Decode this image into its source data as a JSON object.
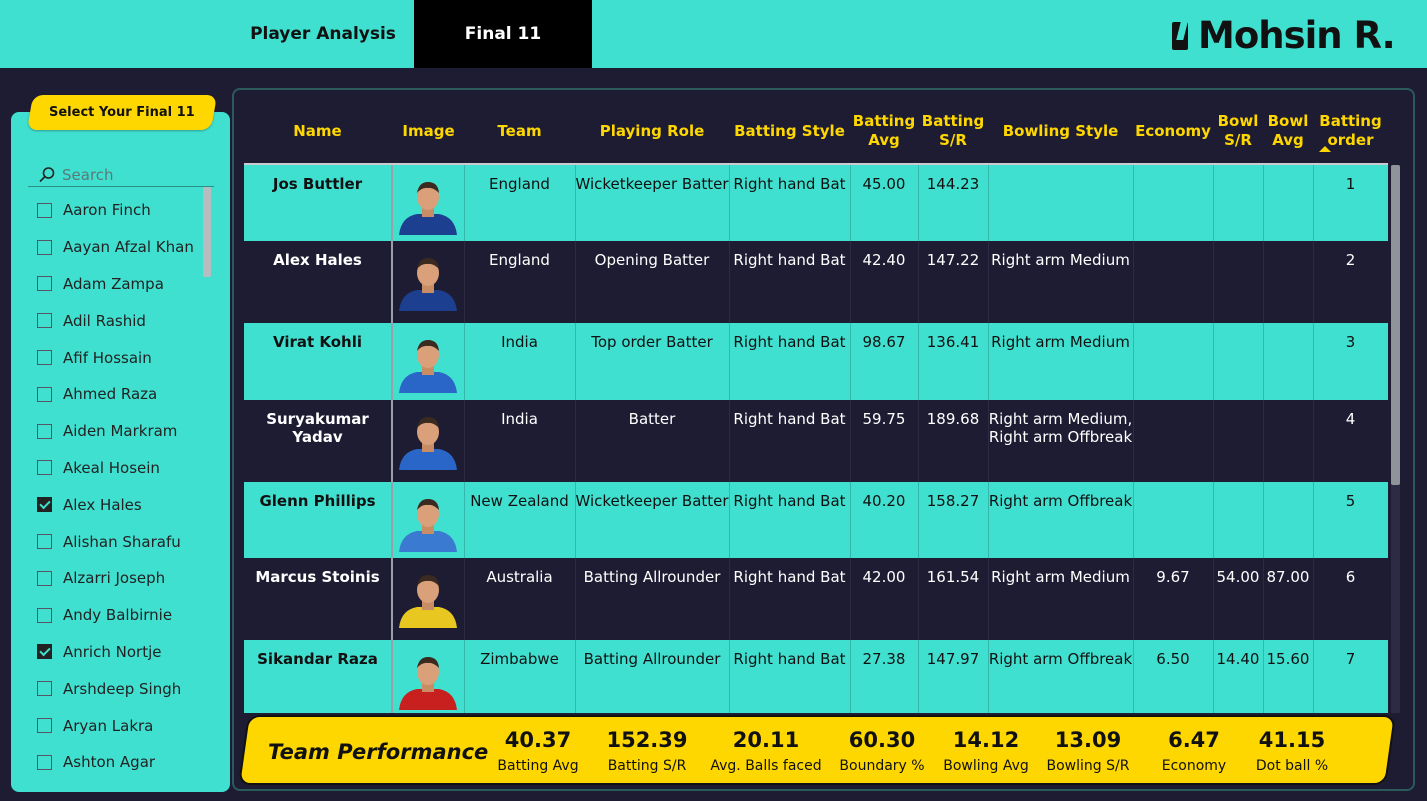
{
  "tabs": [
    {
      "label": "Player Analysis"
    },
    {
      "label": "Final 11"
    }
  ],
  "logo": "Mohsin R.",
  "slicer": {
    "title": "Select Your Final 11",
    "search_placeholder": "Search",
    "items": [
      {
        "label": "Aaron Finch",
        "checked": false
      },
      {
        "label": "Aayan Afzal Khan",
        "checked": false
      },
      {
        "label": "Adam Zampa",
        "checked": false
      },
      {
        "label": "Adil Rashid",
        "checked": false
      },
      {
        "label": "Afif Hossain",
        "checked": false
      },
      {
        "label": "Ahmed Raza",
        "checked": false
      },
      {
        "label": "Aiden Markram",
        "checked": false
      },
      {
        "label": "Akeal Hosein",
        "checked": false
      },
      {
        "label": "Alex Hales",
        "checked": true
      },
      {
        "label": "Alishan Sharafu",
        "checked": false
      },
      {
        "label": "Alzarri Joseph",
        "checked": false
      },
      {
        "label": "Andy Balbirnie",
        "checked": false
      },
      {
        "label": "Anrich Nortje",
        "checked": true
      },
      {
        "label": "Arshdeep Singh",
        "checked": false
      },
      {
        "label": "Aryan Lakra",
        "checked": false
      },
      {
        "label": "Ashton Agar",
        "checked": false
      }
    ]
  },
  "table": {
    "headers": [
      "Name",
      "Image",
      "Team",
      "Playing Role",
      "Batting Style",
      "Batting Avg",
      "Batting S/R",
      "Bowling Style",
      "Economy",
      "Bowl S/R",
      "Bowl Avg",
      "Batting order"
    ],
    "rows": [
      {
        "name": "Jos Buttler",
        "team": "England",
        "role": "Wicketkeeper Batter",
        "bat_style": "Right hand Bat",
        "bat_avg": "45.00",
        "bat_sr": "144.23",
        "bowl_style": "",
        "economy": "",
        "bowl_sr": "",
        "bowl_avg": "",
        "order": "1",
        "jersey": "#1d3f8f"
      },
      {
        "name": "Alex Hales",
        "team": "England",
        "role": "Opening Batter",
        "bat_style": "Right hand Bat",
        "bat_avg": "42.40",
        "bat_sr": "147.22",
        "bowl_style": "Right arm Medium",
        "economy": "",
        "bowl_sr": "",
        "bowl_avg": "",
        "order": "2",
        "jersey": "#1d3f8f"
      },
      {
        "name": "Virat Kohli",
        "team": "India",
        "role": "Top order Batter",
        "bat_style": "Right hand Bat",
        "bat_avg": "98.67",
        "bat_sr": "136.41",
        "bowl_style": "Right arm Medium",
        "economy": "",
        "bowl_sr": "",
        "bowl_avg": "",
        "order": "3",
        "jersey": "#2a66c8"
      },
      {
        "name": "Suryakumar Yadav",
        "team": "India",
        "role": "Batter",
        "bat_style": "Right hand Bat",
        "bat_avg": "59.75",
        "bat_sr": "189.68",
        "bowl_style": "Right arm Medium, Right arm Offbreak",
        "economy": "",
        "bowl_sr": "",
        "bowl_avg": "",
        "order": "4",
        "jersey": "#2a66c8"
      },
      {
        "name": "Glenn Phillips",
        "team": "New Zealand",
        "role": "Wicketkeeper Batter",
        "bat_style": "Right hand Bat",
        "bat_avg": "40.20",
        "bat_sr": "158.27",
        "bowl_style": "Right arm Offbreak",
        "economy": "",
        "bowl_sr": "",
        "bowl_avg": "",
        "order": "5",
        "jersey": "#3a7ad0"
      },
      {
        "name": "Marcus Stoinis",
        "team": "Australia",
        "role": "Batting Allrounder",
        "bat_style": "Right hand Bat",
        "bat_avg": "42.00",
        "bat_sr": "161.54",
        "bowl_style": "Right arm Medium",
        "economy": "9.67",
        "bowl_sr": "54.00",
        "bowl_avg": "87.00",
        "order": "6",
        "jersey": "#e8c820"
      },
      {
        "name": "Sikandar Raza",
        "team": "Zimbabwe",
        "role": "Batting Allrounder",
        "bat_style": "Right hand Bat",
        "bat_avg": "27.38",
        "bat_sr": "147.97",
        "bowl_style": "Right arm Offbreak",
        "economy": "6.50",
        "bowl_sr": "14.40",
        "bowl_avg": "15.60",
        "order": "7",
        "jersey": "#c8201e"
      }
    ]
  },
  "performance": {
    "title": "Team Performance",
    "kpis": [
      {
        "value": "40.37",
        "label": "Batting Avg"
      },
      {
        "value": "152.39",
        "label": "Batting S/R"
      },
      {
        "value": "20.11",
        "label": "Avg. Balls faced"
      },
      {
        "value": "60.30",
        "label": "Boundary %"
      },
      {
        "value": "14.12",
        "label": "Bowling Avg"
      },
      {
        "value": "13.09",
        "label": "Bowling S/R"
      },
      {
        "value": "6.47",
        "label": "Economy"
      },
      {
        "value": "41.15",
        "label": "Dot ball %"
      }
    ]
  },
  "colors": {
    "accent": "#40e0d0",
    "highlight": "#ffd700",
    "dark": "#1e1c33"
  }
}
